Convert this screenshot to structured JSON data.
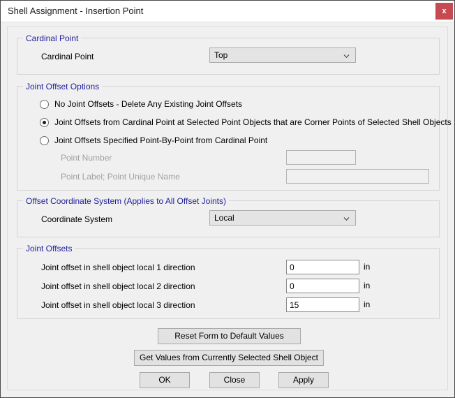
{
  "window": {
    "title": "Shell Assignment - Insertion Point",
    "close_label": "x",
    "accent_color": "#c74a52",
    "group_title_color": "#21219c"
  },
  "cardinal_point": {
    "group_title": "Cardinal Point",
    "label": "Cardinal Point",
    "value": "Top"
  },
  "joint_offset_options": {
    "group_title": "Joint Offset Options",
    "options": [
      {
        "label": "No Joint Offsets - Delete Any Existing Joint Offsets",
        "checked": false
      },
      {
        "label": "Joint Offsets from Cardinal Point at Selected Point Objects that are Corner Points of Selected Shell Objects",
        "checked": true
      },
      {
        "label": "Joint Offsets Specified Point-By-Point from Cardinal Point",
        "checked": false
      }
    ],
    "point_number": {
      "label": "Point Number",
      "value": "",
      "enabled": false
    },
    "point_label": {
      "label": "Point Label;  Point Unique Name",
      "value": "",
      "enabled": false
    }
  },
  "offset_coordinate_system": {
    "group_title": "Offset Coordinate System  (Applies to All Offset Joints)",
    "label": "Coordinate System",
    "value": "Local"
  },
  "joint_offsets": {
    "group_title": "Joint Offsets",
    "rows": [
      {
        "label": "Joint offset in shell object local 1 direction",
        "value": "0",
        "unit": "in"
      },
      {
        "label": "Joint offset in shell object local 2 direction",
        "value": "0",
        "unit": "in"
      },
      {
        "label": "Joint offset in shell object local 3 direction",
        "value": "15",
        "unit": "in"
      }
    ]
  },
  "actions": {
    "reset": "Reset Form to Default Values",
    "get_values": "Get Values from Currently Selected Shell Object",
    "ok": "OK",
    "close": "Close",
    "apply": "Apply"
  }
}
